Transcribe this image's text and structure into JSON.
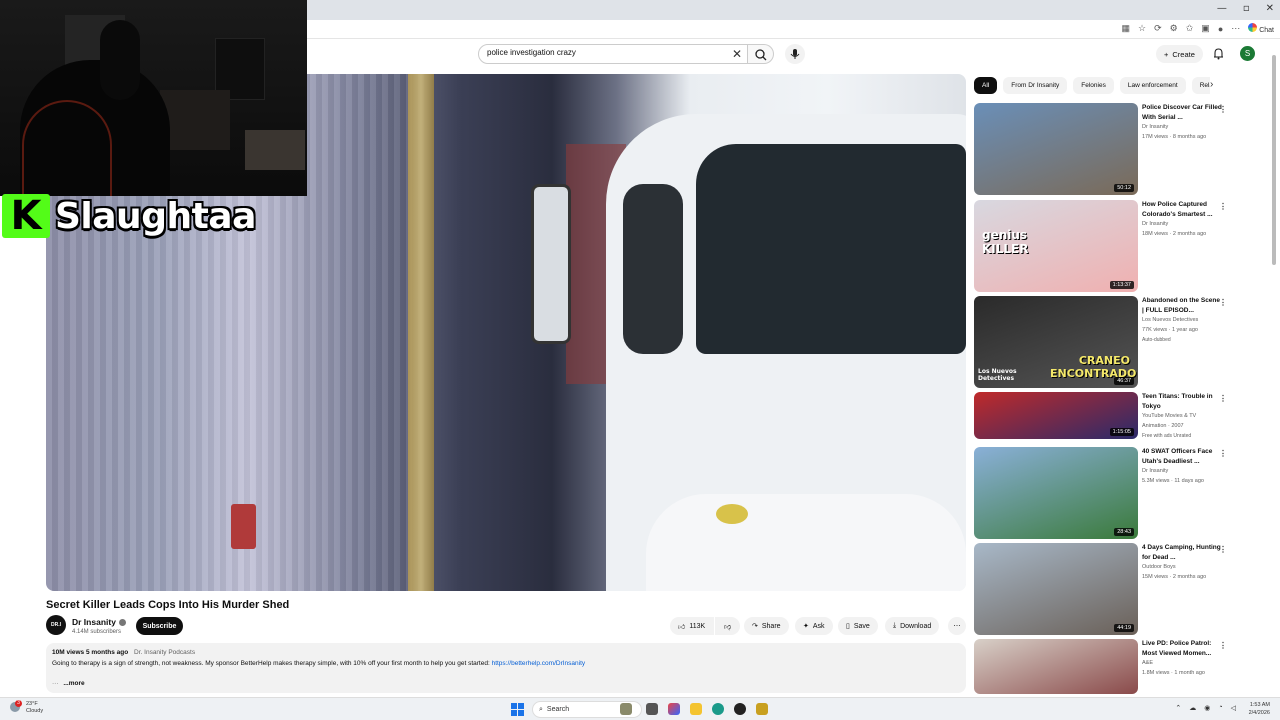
{
  "browser": {
    "controls": [
      "—",
      "▫",
      "✕"
    ],
    "chat_label": "Chat"
  },
  "overlay": {
    "streamer_name": "Slaughtaa",
    "logo_letter": "K"
  },
  "header": {
    "search_value": "police investigation crazy",
    "create_label": "Create",
    "user_initial": "S"
  },
  "video": {
    "title": "Secret Killer Leads Cops Into His Murder Shed",
    "channel_name": "Dr Insanity",
    "channel_avatar_text": "DR.I",
    "subscribers": "4.14M subscribers",
    "subscribe_label": "Subscribe",
    "likes": "113K",
    "share_label": "Share",
    "ask_label": "Ask",
    "save_label": "Save",
    "download_label": "Download",
    "views_age": "10M views  5 months ago",
    "podcast_tag": "Dr. Insanity Podcasts",
    "description": "Going to therapy is a sign of strength, not weakness. My sponsor BetterHelp makes therapy simple, with 10% off your first month to help you get started: ",
    "description_link": "https://betterhelp.com/DrInsanity",
    "more_dots": "···",
    "more_label": "...more"
  },
  "chips": [
    "All",
    "From Dr Insanity",
    "Felonies",
    "Law enforcement",
    "Rela"
  ],
  "related": [
    {
      "title": "Police Discover Car Filled With Serial ...",
      "channel": "Dr Insanity",
      "meta": "17M views · 8 months ago",
      "duration": "50:12",
      "thumb_colors": [
        "#6a8fb8",
        "#7a6a58"
      ]
    },
    {
      "title": "How Police Captured Colorado's Smartest ...",
      "channel": "Dr Insanity",
      "meta": "18M views · 2 months ago",
      "duration": "1:13:37",
      "thumb_colors": [
        "#d8d8e0",
        "#f0b0b0"
      ],
      "thumb_text": "genius KILLER"
    },
    {
      "title": "Abandoned on the Scene | FULL EPISOD...",
      "channel": "Los Nuevos Detectives",
      "meta": "77K views · 1 year ago",
      "extra": "Auto-dubbed",
      "duration": "46:37",
      "thumb_colors": [
        "#2a2a2a",
        "#555"
      ],
      "thumb_text": "CRANEO ENCONTRADO",
      "thumb_text2": "Los Nuevos Detectives"
    },
    {
      "title": "Teen Titans: Trouble in Tokyo",
      "channel": "YouTube Movies & TV",
      "meta": "Animation · 2007",
      "extra": "Free with ads   Unrated",
      "duration": "1:15:05",
      "thumb_colors": [
        "#c02a2a",
        "#2a2a6a"
      ]
    },
    {
      "title": "40 SWAT Officers Face Utah's Deadliest ...",
      "channel": "Dr Insanity",
      "meta": "5.3M views · 11 days ago",
      "duration": "28:43",
      "thumb_colors": [
        "#8ab0d8",
        "#3a7a3a"
      ]
    },
    {
      "title": "4 Days Camping, Hunting for Dead ...",
      "channel": "Outdoor Boys",
      "meta": "15M views · 2 months ago",
      "duration": "44:19",
      "thumb_colors": [
        "#a8b8c8",
        "#6a6058"
      ]
    },
    {
      "title": "Live PD: Police Patrol: Most Viewed Momen...",
      "channel": "A&E",
      "meta": "1.8M views · 1 month ago",
      "duration": "",
      "thumb_colors": [
        "#d8d0c8",
        "#8a4a4a"
      ]
    }
  ],
  "taskbar": {
    "temp": "23°F",
    "condition": "Cloudy",
    "badge": "3",
    "search_label": "Search",
    "time": "1:53 AM",
    "date": "2/4/2026"
  }
}
